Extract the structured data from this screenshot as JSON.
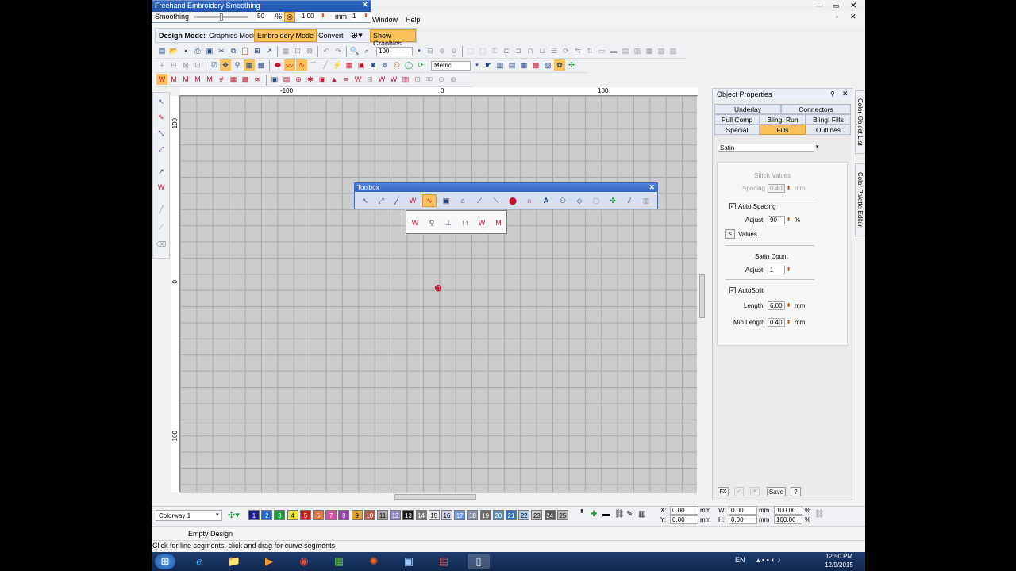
{
  "smoothing_popup": {
    "title": "Freehand Embroidery Smoothing",
    "label": "Smoothing",
    "value": "50",
    "unit_percent": "%",
    "value2": "1.00",
    "unit_mm": "mm",
    "value3": "1"
  },
  "menu": {
    "window": "Window",
    "help": "Help"
  },
  "design_mode": {
    "label": "Design Mode:",
    "graphics": "Graphics Mode",
    "embroidery": "Embroidery Mode",
    "convert": "Convert",
    "show_graphics": "Show Graphics"
  },
  "toolbar": {
    "zoom": "100",
    "units": "Metric"
  },
  "rulers": {
    "top_left": "-100",
    "top_zero": "0",
    "top_right": "100",
    "left_top": "100",
    "left_zero": "0",
    "left_bottom": "-100"
  },
  "toolbox": {
    "title": "Toolbox"
  },
  "object_properties": {
    "title": "Object Properties",
    "tabs": [
      "Underlay",
      "Connectors",
      "Pull Comp",
      "Bling! Run",
      "Bling! Fills",
      "Special",
      "Fills",
      "Outlines"
    ],
    "fill_type": "Satin",
    "stitch_values": "Stitch Values",
    "spacing_label": "Spacing",
    "spacing_value": "0.40",
    "mm": "mm",
    "auto_spacing": "Auto Spacing",
    "adjust_label": "Adjust",
    "adjust_value": "90",
    "percent": "%",
    "values_btn": "Values...",
    "satin_count": "Satin Count",
    "satin_adjust_value": "1",
    "autosplit": "AutoSplit",
    "length_label": "Length",
    "length_value": "6.00",
    "min_length_label": "Min Length",
    "min_length_value": "0.40",
    "save": "Save",
    "fx": "FX",
    "question": "?"
  },
  "side_tabs": {
    "color_object_list": "Color-Object List",
    "color_palette_editor": "Color Palette Editor"
  },
  "colorway": {
    "label": "Colorway 1",
    "swatches": [
      {
        "n": "1",
        "c": "#1b1b8f"
      },
      {
        "n": "2",
        "c": "#1c64c8"
      },
      {
        "n": "3",
        "c": "#179a3a"
      },
      {
        "n": "4",
        "c": "#e8e02c"
      },
      {
        "n": "5",
        "c": "#c41e1e"
      },
      {
        "n": "6",
        "c": "#e8743a"
      },
      {
        "n": "7",
        "c": "#d14fa5"
      },
      {
        "n": "8",
        "c": "#9b3fa8"
      },
      {
        "n": "9",
        "c": "#e3a128"
      },
      {
        "n": "10",
        "c": "#b75a46"
      },
      {
        "n": "11",
        "c": "#a6a6a6"
      },
      {
        "n": "12",
        "c": "#8f8fc2"
      },
      {
        "n": "13",
        "c": "#1a1a1a"
      },
      {
        "n": "14",
        "c": "#7a7a7a"
      },
      {
        "n": "15",
        "c": "#e8e8e8"
      },
      {
        "n": "16",
        "c": "#cfcfe8"
      },
      {
        "n": "17",
        "c": "#6e98d8"
      },
      {
        "n": "18",
        "c": "#8c96a8"
      },
      {
        "n": "19",
        "c": "#6c6c6c"
      },
      {
        "n": "20",
        "c": "#5e8fb0"
      },
      {
        "n": "21",
        "c": "#2e72c4"
      },
      {
        "n": "22",
        "c": "#a9cde6"
      },
      {
        "n": "23",
        "c": "#c7c7c7"
      },
      {
        "n": "24",
        "c": "#5a5a5a"
      },
      {
        "n": "25",
        "c": "#b3b3b3"
      }
    ]
  },
  "coords": {
    "x_label": "X:",
    "x_value": "0.00",
    "y_label": "Y:",
    "y_value": "0.00",
    "w_label": "W:",
    "w_value": "0.00",
    "h_label": "H:",
    "h_value": "0.00",
    "mm": "mm",
    "pct_w": "100.00",
    "pct_h": "100.00",
    "pct": "%"
  },
  "status": {
    "document": "Empty Design",
    "hint": "Click for line segments, click and drag for curve segments"
  },
  "taskbar": {
    "lang": "EN",
    "time": "12:50 PM",
    "date": "12/9/2015"
  }
}
